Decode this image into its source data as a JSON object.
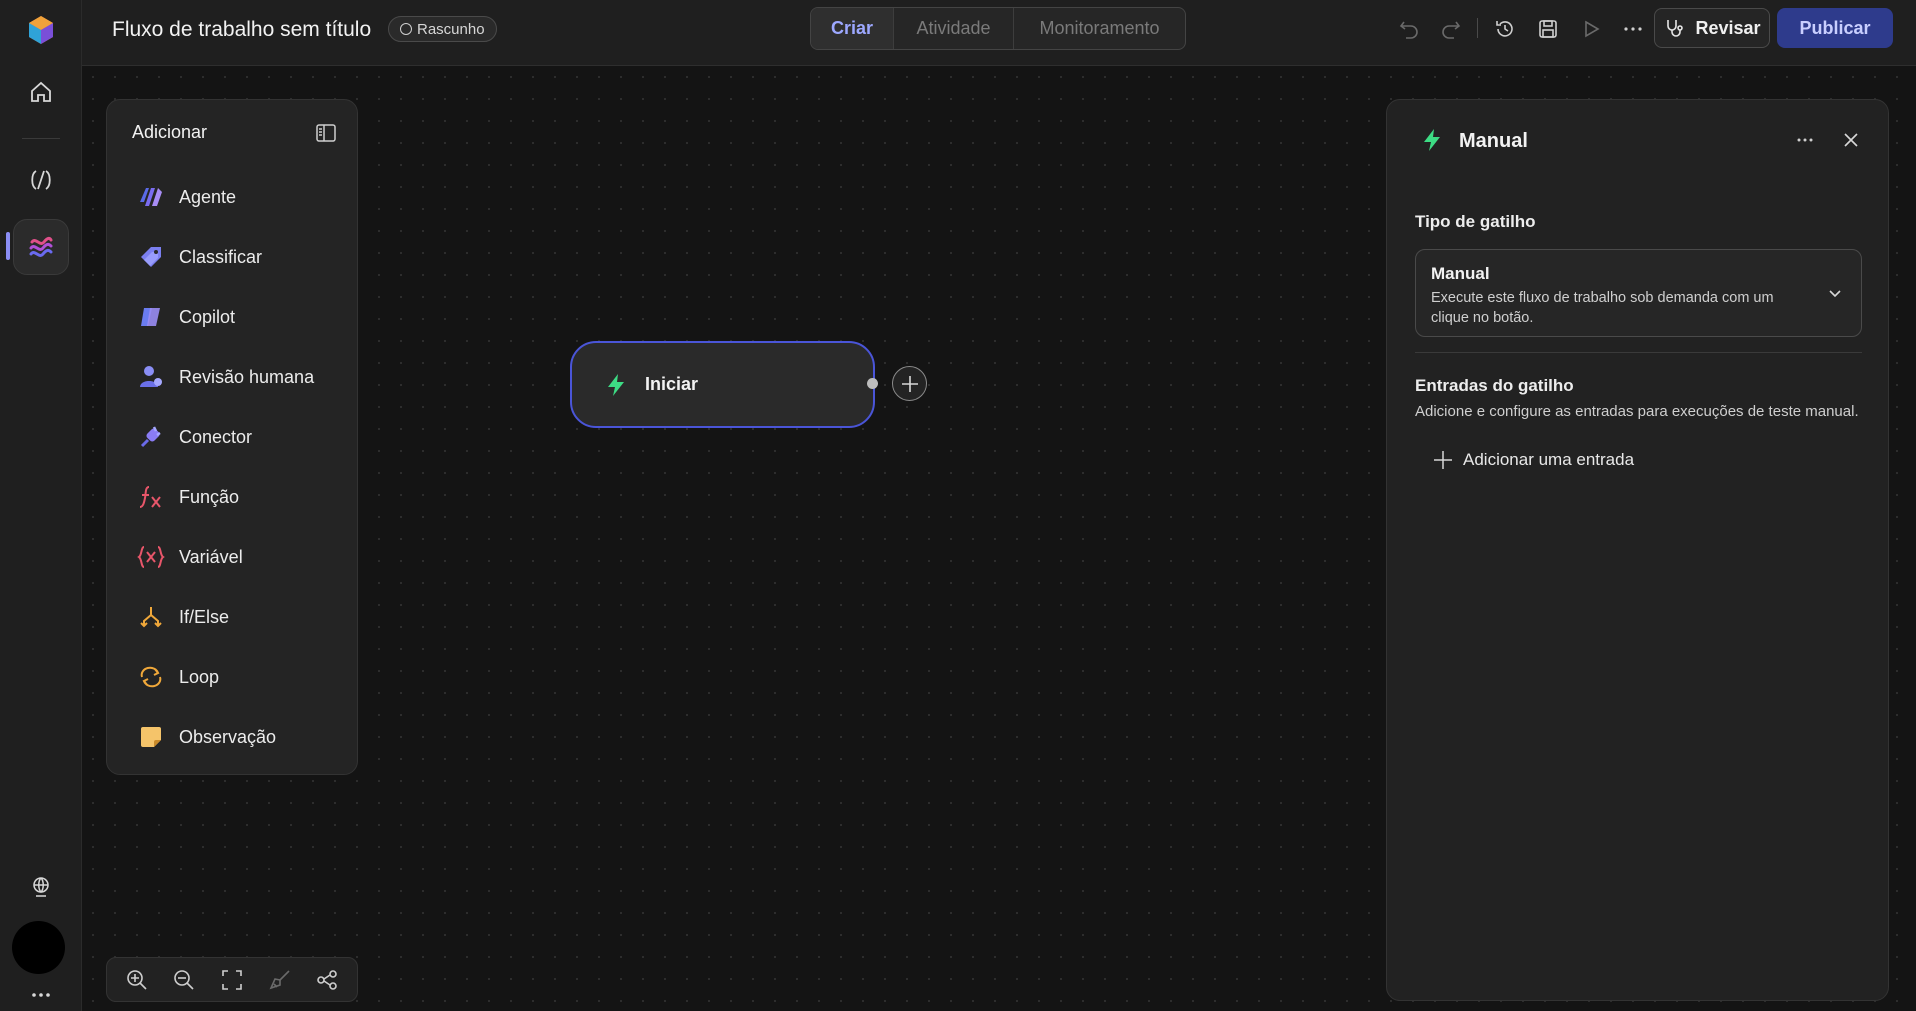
{
  "app": {
    "title": "Fluxo de trabalho sem título",
    "status_badge": "Rascunho"
  },
  "tabs": [
    {
      "label": "Criar",
      "active": true
    },
    {
      "label": "Atividade",
      "active": false
    },
    {
      "label": "Monitoramento",
      "active": false
    }
  ],
  "toolbar": {
    "review_label": "Revisar",
    "publish_label": "Publicar",
    "icons": [
      "undo-icon",
      "redo-icon",
      "history-icon",
      "save-icon",
      "play-icon",
      "more-icon"
    ]
  },
  "add_panel": {
    "title": "Adicionar",
    "items": [
      {
        "label": "Agente",
        "icon": "agent-icon"
      },
      {
        "label": "Classificar",
        "icon": "tag-icon"
      },
      {
        "label": "Copilot",
        "icon": "copilot-icon"
      },
      {
        "label": "Revisão humana",
        "icon": "person-icon"
      },
      {
        "label": "Conector",
        "icon": "plug-icon"
      },
      {
        "label": "Função",
        "icon": "function-icon"
      },
      {
        "label": "Variável",
        "icon": "variable-icon"
      },
      {
        "label": "If/Else",
        "icon": "branch-icon"
      },
      {
        "label": "Loop",
        "icon": "loop-icon"
      },
      {
        "label": "Observação",
        "icon": "note-icon"
      }
    ]
  },
  "canvas": {
    "start_node_label": "Iniciar"
  },
  "properties": {
    "title": "Manual",
    "trigger_type_label": "Tipo de gatilho",
    "trigger": {
      "name": "Manual",
      "description": "Execute este fluxo de trabalho sob demanda com um clique no botão."
    },
    "inputs_label": "Entradas do gatilho",
    "inputs_description": "Adicione e configure as entradas para execuções de teste manual.",
    "add_input_label": "Adicionar uma entrada"
  },
  "colors": {
    "accent": "#9da8ff",
    "publish_bg": "#2e3b8c",
    "node_border": "#4a55d8",
    "trigger_green": "#3ddc84"
  }
}
